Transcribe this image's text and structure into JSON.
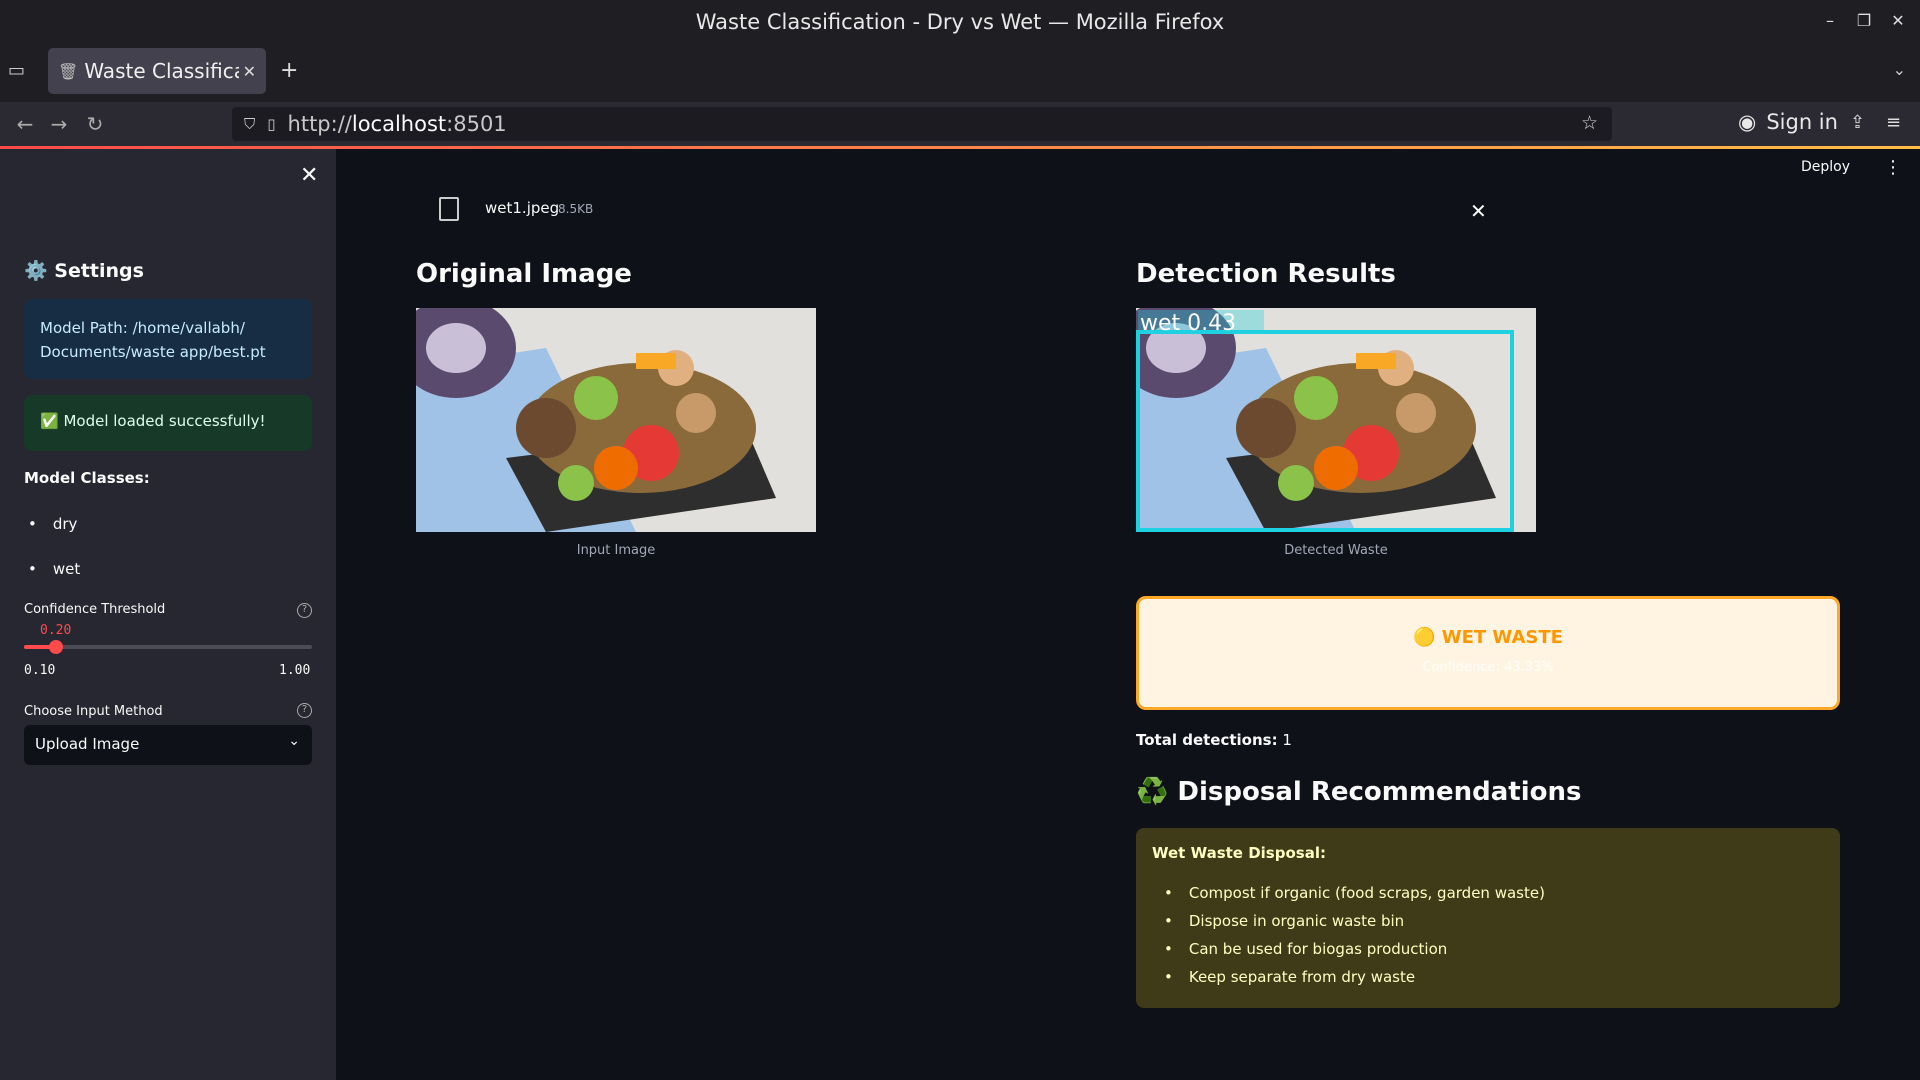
{
  "window": {
    "title": "Waste Classification - Dry vs Wet — Mozilla Firefox"
  },
  "tab": {
    "label": "Waste Classificati",
    "favicon": "wastebasket-icon"
  },
  "navbar": {
    "url_prefix": "http://",
    "url_host": "localhost",
    "url_port": ":8501",
    "signin": "Sign in"
  },
  "sidebar": {
    "heading": "⚙️ Settings",
    "model_path": "Model Path: /home/vallabh/ Documents/waste app/best.pt",
    "status": "✅ Model loaded successfully!",
    "classes_heading": "Model Classes:",
    "classes": [
      "dry",
      "wet"
    ],
    "slider_label": "Confidence Threshold",
    "slider_value": "0.20",
    "slider_min": "0.10",
    "slider_max": "1.00",
    "slider_fraction": 0.111,
    "select_label": "Choose Input Method",
    "select_value": "Upload Image"
  },
  "header": {
    "deploy": "Deploy"
  },
  "upload": {
    "filename": "wet1.jpeg",
    "size": "8.5KB"
  },
  "columns": {
    "left": {
      "title": "Original Image",
      "caption": "Input Image"
    },
    "right": {
      "title": "Detection Results",
      "caption": "Detected Waste",
      "box_label": "wet 0.43"
    }
  },
  "result": {
    "label": "🟡 WET WASTE",
    "confidence": "Confidence: 43.33%"
  },
  "detections": {
    "label": "Total detections:",
    "value": "1"
  },
  "disposal": {
    "heading": "♻️ Disposal Recommendations",
    "title": "Wet Waste Disposal:",
    "items": [
      "Compost if organic (food scraps, garden waste)",
      "Dispose in organic waste bin",
      "Can be used for biogas production",
      "Keep separate from dry waste"
    ]
  },
  "colors": {
    "accent": "#ff4b4b",
    "result_border": "#ffa726",
    "box": "#1fd1e0"
  }
}
